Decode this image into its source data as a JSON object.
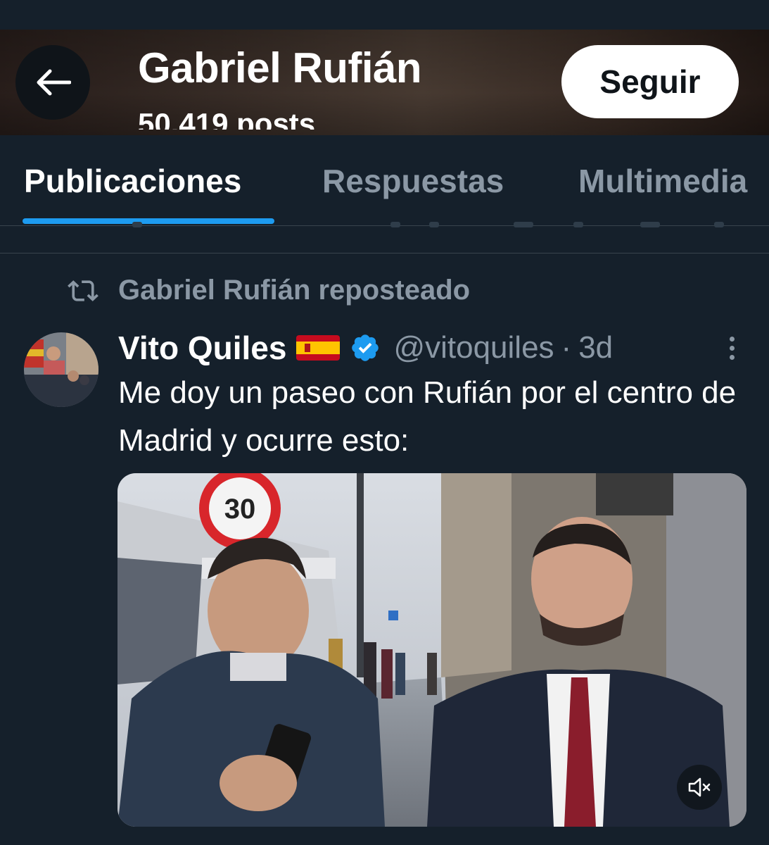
{
  "header": {
    "back_icon": "arrow-left-icon",
    "profile_name": "Gabriel Rufián",
    "posts_count": "50.419 posts",
    "follow_label": "Seguir"
  },
  "tabs": [
    {
      "label": "Publicaciones",
      "active": true
    },
    {
      "label": "Respuestas",
      "active": false
    },
    {
      "label": "Multimedia",
      "active": false
    }
  ],
  "repost": {
    "icon": "repost-icon",
    "text": "Gabriel Rufián reposteado"
  },
  "tweet": {
    "author_name": "Vito Quiles",
    "flag_icon": "spain-flag-icon",
    "verified_icon": "verified-badge-icon",
    "handle": "@vitoquiles",
    "separator": "·",
    "time": "3d",
    "more_icon": "more-options-icon",
    "text": "Me doy un paseo con Rufián por el centro de Madrid y ocurre esto:",
    "media": {
      "type": "video",
      "sign_text": "30",
      "mute_icon": "volume-muted-icon"
    }
  },
  "colors": {
    "background": "#15202b",
    "accent": "#1d9bf0",
    "secondary_text": "#8b98a5",
    "primary_text": "#ffffff"
  }
}
